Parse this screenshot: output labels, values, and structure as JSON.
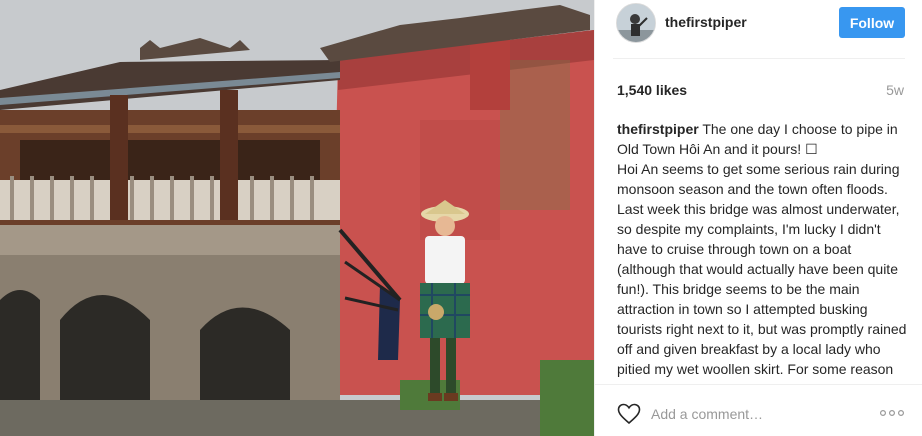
{
  "post": {
    "photo_icon": "photo-of-piper-at-japanese-bridge",
    "username": "thefirstpiper",
    "follow_label": "Follow",
    "likes": "1,540 likes",
    "age": "5w",
    "caption_user": "thefirstpiper",
    "caption_text": " The one day I choose to pipe in Old Town Hôi An and it pours! ☐\nHoi An seems to get some serious rain during monsoon season and the town often floods. Last week this bridge was almost underwater, so despite my complaints, I'm lucky I didn't have to cruise through town on a boat (although that would actually have been quite fun!). This bridge seems to be the main attraction in town so I attempted busking tourists right next to it, but was promptly rained off and given breakfast by a local lady who pitied my wet woollen skirt. For some reason she was most concerned about my hair getting wet",
    "comment_placeholder": "Add a comment…",
    "follow_color": "#3897f0"
  }
}
